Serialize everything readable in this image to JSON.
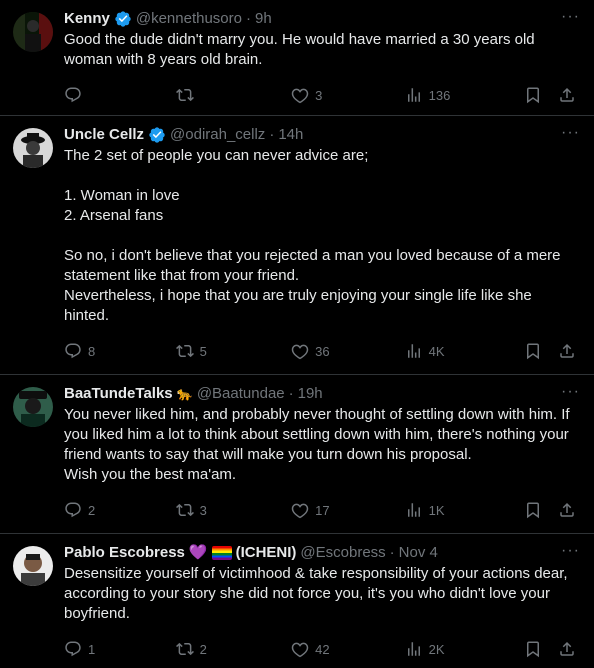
{
  "colors": {
    "background": "#000000",
    "text": "#e7e9ea",
    "muted": "#71767b",
    "divider": "#2f3336",
    "verified": "#1d9bf0"
  },
  "tweets": [
    {
      "name": "Kenny",
      "handle": "@kennethusoro",
      "time": "9h",
      "verified": true,
      "text": "Good the dude didn't marry you. He would have married a 30 years old woman with 8 years old brain.",
      "replies": "",
      "retweets": "",
      "likes": "3",
      "views": "136"
    },
    {
      "name": "Uncle Cellz",
      "handle": "@odirah_cellz",
      "time": "14h",
      "verified": true,
      "text": "The 2 set of people you can never advice are;\n\n1. Woman in love\n2. Arsenal fans\n\nSo no, i don't believe that you rejected a man you loved because of a mere statement like that from your friend.\nNevertheless, i hope that you are truly enjoying your single life like she hinted.",
      "replies": "8",
      "retweets": "5",
      "likes": "36",
      "views": "4K"
    },
    {
      "name": "BaaTundeTalks",
      "name_emoji": "🐆",
      "handle": "@Baatundae",
      "time": "19h",
      "verified": false,
      "text": "You never liked him, and probably never thought of settling down with him. If you liked him a lot to think about settling down with him, there's nothing your friend wants to say that will make you turn down his proposal.\nWish you the best ma'am.",
      "replies": "2",
      "retweets": "3",
      "likes": "17",
      "views": "1K"
    },
    {
      "name": "Pablo Escobress",
      "name_emoji": "💜",
      "name_suffix": "(ICHENI)",
      "handle": "@Escobress",
      "time": "Nov 4",
      "verified": false,
      "text": "Desensitize yourself of victimhood & take responsibility of your actions dear, according to your story she did not force you, it's you who didn't love your boyfriend.",
      "replies": "1",
      "retweets": "2",
      "likes": "42",
      "views": "2K"
    }
  ],
  "icons": {
    "reply": "reply-icon",
    "retweet": "retweet-icon",
    "like": "heart-icon",
    "views": "views-icon",
    "bookmark": "bookmark-icon",
    "share": "share-icon",
    "more": "more-icon",
    "verified": "verified-badge-icon"
  }
}
